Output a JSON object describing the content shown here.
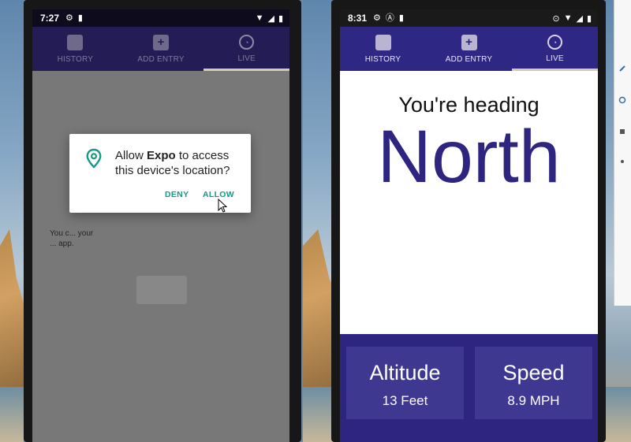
{
  "left_phone": {
    "status": {
      "time": "7:27"
    },
    "tabs": [
      {
        "label": "HISTORY",
        "icon": "book-icon"
      },
      {
        "label": "ADD ENTRY",
        "icon": "plus-box-icon"
      },
      {
        "label": "LIVE",
        "icon": "speedometer-icon",
        "active": true
      }
    ],
    "behind_text": "You c... your ... app.",
    "dialog": {
      "text_prefix": "Allow ",
      "text_app": "Expo",
      "text_suffix": " to access this device's location?",
      "deny_label": "DENY",
      "allow_label": "ALLOW",
      "accent_color": "#159886"
    }
  },
  "right_phone": {
    "status": {
      "time": "8:31"
    },
    "tabs": [
      {
        "label": "HISTORY",
        "icon": "book-icon"
      },
      {
        "label": "ADD ENTRY",
        "icon": "plus-box-icon"
      },
      {
        "label": "LIVE",
        "icon": "speedometer-icon",
        "active": true
      }
    ],
    "heading_label": "You're heading",
    "direction": "North",
    "stats": [
      {
        "title": "Altitude",
        "value": "13 Feet"
      },
      {
        "title": "Speed",
        "value": "8.9 MPH"
      }
    ],
    "brand_color": "#2d2580"
  }
}
